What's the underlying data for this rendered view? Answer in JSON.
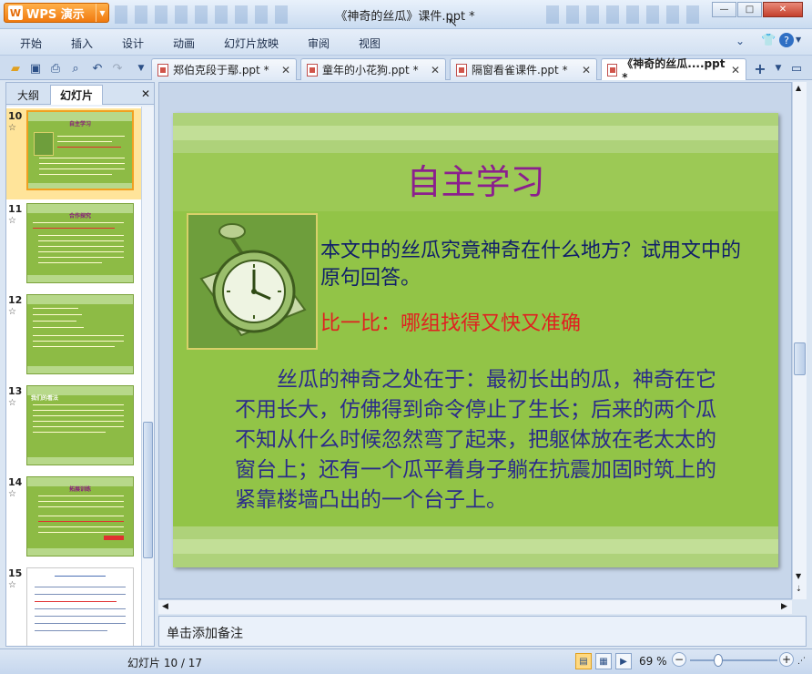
{
  "app": {
    "name": "WPS 演示",
    "window_title": "《神奇的丝瓜》课件.ppt *"
  },
  "window_buttons": {
    "minimize": "—",
    "maximize": "□",
    "close": "✕"
  },
  "menu": [
    "开始",
    "插入",
    "设计",
    "动画",
    "幻灯片放映",
    "审阅",
    "视图"
  ],
  "tabs": [
    {
      "label": "郑伯克段于鄢.ppt *",
      "active": false
    },
    {
      "label": "童年的小花狗.ppt *",
      "active": false
    },
    {
      "label": "隔窗看雀课件.ppt *",
      "active": false
    },
    {
      "label": "《神奇的丝瓜....ppt *",
      "active": true
    }
  ],
  "panel": {
    "tab_outline": "大纲",
    "tab_slides": "幻灯片",
    "close": "✕"
  },
  "thumbnails": [
    {
      "num": "10",
      "title": "自主学习",
      "selected": true
    },
    {
      "num": "11",
      "title": "合作探究",
      "selected": false
    },
    {
      "num": "12",
      "title": "",
      "selected": false
    },
    {
      "num": "13",
      "title": "我们的看法",
      "selected": false
    },
    {
      "num": "14",
      "title": "拓展训练",
      "selected": false
    },
    {
      "num": "15",
      "title": "",
      "selected": false
    }
  ],
  "slide": {
    "title": "自主学习",
    "question": "本文中的丝瓜究竟神奇在什么地方？试用文中的原句回答。",
    "challenge": "比一比：哪组找得又快又准确",
    "answer": "丝瓜的神奇之处在于：最初长出的瓜，神奇在它不用长大，仿佛得到命令停止了生长；后来的两个瓜不知从什么时候忽然弯了起来，把躯体放在老太太的窗台上；还有一个瓜平着身子躺在抗震加固时筑上的紧靠楼墙凸出的一个台子上。"
  },
  "notes_placeholder": "单击添加备注",
  "status": {
    "slide_counter": "幻灯片 10 / 17",
    "zoom": "69 %"
  },
  "colors": {
    "slide_bg": "#92c447",
    "title": "#8b1f8e",
    "question": "#101e6a",
    "challenge": "#e02020",
    "app_button": "#f07a10"
  }
}
